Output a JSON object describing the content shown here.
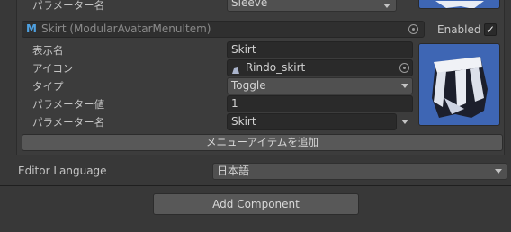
{
  "top_row": {
    "label": "パラメーター名",
    "value": "Sleeve"
  },
  "menu_item": {
    "header_title": "Skirt (ModularAvatarMenuItem)",
    "enabled_label": "Enabled",
    "enabled_checked": true,
    "display_name_label": "表示名",
    "display_name_value": "Skirt",
    "icon_label": "アイコン",
    "icon_value": "Rindo_skirt",
    "type_label": "タイプ",
    "type_value": "Toggle",
    "param_value_label": "パラメーター値",
    "param_value_value": "1",
    "param_name_label": "パラメーター名",
    "param_name_value": "Skirt",
    "add_menu_item_button": "メニューアイテムを追加"
  },
  "editor_language": {
    "label": "Editor Language",
    "value": "日本語"
  },
  "add_component_button": "Add Component",
  "colors": {
    "background": "#383838",
    "field": "#2a2a2a",
    "button": "#585858",
    "thumbnail": "#3e66b4"
  }
}
